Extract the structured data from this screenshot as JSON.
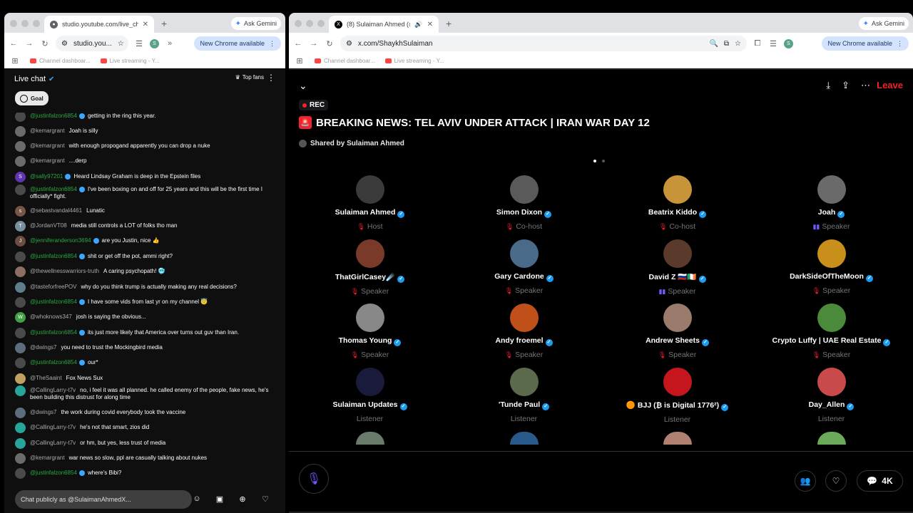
{
  "left_window": {
    "tab_title": "studio.youtube.com/live_cha",
    "ask_gemini": "Ask Gemini",
    "url": "studio.you...",
    "new_chrome": "New Chrome available",
    "profile_initial": "S",
    "bookmarks": [
      "Channel dashboar...",
      "Live streaming - Y..."
    ]
  },
  "chat": {
    "title": "Live chat",
    "top_fans": "Top fans",
    "goal": "Goal",
    "input_placeholder": "Chat publicly as @SulaimanAhmedX...",
    "messages": [
      {
        "author": "@justinfalzon6854",
        "member": true,
        "text": "getting in the ring this year.",
        "color": "#4a4a4a"
      },
      {
        "author": "@kemargrant",
        "member": false,
        "text": "Joah is silly",
        "color": "#6b6b6b"
      },
      {
        "author": "@kemargrant",
        "member": false,
        "text": "with enough propogand apparently you can drop a nuke",
        "color": "#6b6b6b"
      },
      {
        "author": "@kemargrant",
        "member": false,
        "text": "....derp",
        "color": "#6b6b6b"
      },
      {
        "author": "@sally97201",
        "member": true,
        "text": "Heard Lindsay Graham is deep in the Epstein files",
        "color": "#5e35b1",
        "initial": "S"
      },
      {
        "author": "@justinfalzon6854",
        "member": true,
        "text": "I've been boxing on and off for 25 years and this will be the first time I officially* fight.",
        "color": "#4a4a4a"
      },
      {
        "author": "@sebastvandal4461",
        "member": false,
        "text": "Lunatic",
        "color": "#795548",
        "initial": "s"
      },
      {
        "author": "@JordanVT08",
        "member": false,
        "text": "media still controls a LOT of folks tho man",
        "color": "#78909c",
        "initial": "T"
      },
      {
        "author": "@jenniferanderson3694",
        "member": true,
        "text": "are you Justin, nice 👍",
        "color": "#6d4c41",
        "initial": "J"
      },
      {
        "author": "@justinfalzon6854",
        "member": true,
        "text": "shit or get off the pot, ammi right?",
        "color": "#4a4a4a"
      },
      {
        "author": "@thewellnesswarriors-truth",
        "member": false,
        "text": "A caring psychopath! 🥶",
        "color": "#8d6e63"
      },
      {
        "author": "@tasteforfreePOV",
        "member": false,
        "text": "why do you think trump is actually making any real decisions?",
        "color": "#607d8b"
      },
      {
        "author": "@justinfalzon6854",
        "member": true,
        "text": "I have some vids from last yr on my channel 😇",
        "color": "#4a4a4a"
      },
      {
        "author": "@whoknows347",
        "member": false,
        "text": "josh is saying the obvious...",
        "color": "#43a047",
        "initial": "W"
      },
      {
        "author": "@justinfalzon6854",
        "member": true,
        "text": "its just more likely that America over turns out guv than Iran.",
        "color": "#4a4a4a"
      },
      {
        "author": "@dwings7",
        "member": false,
        "text": "you need to trust the Mockingbird media",
        "color": "#5d6d7e"
      },
      {
        "author": "@justinfalzon6854",
        "member": true,
        "text": "our*",
        "color": "#4a4a4a"
      },
      {
        "author": "@TheSaaint",
        "member": false,
        "text": "Fox News Sux",
        "color": "#c0a060"
      },
      {
        "author": "@CallingLarry-t7v",
        "member": false,
        "text": "no, i feel it was all planned. he called enemy of the people, fake news, he's been building this distrust for along time",
        "color": "#26a69a"
      },
      {
        "author": "@dwings7",
        "member": false,
        "text": "the work during covid everybody took the vaccine",
        "color": "#5d6d7e"
      },
      {
        "author": "@CallingLarry-t7v",
        "member": false,
        "text": "he's not that smart, zios did",
        "color": "#26a69a"
      },
      {
        "author": "@CallingLarry-t7v",
        "member": false,
        "text": "or hm, but yes, less trust of media",
        "color": "#26a69a"
      },
      {
        "author": "@kemargrant",
        "member": false,
        "text": "war news so slow, ppl are casually talking about nukes",
        "color": "#6b6b6b"
      },
      {
        "author": "@justinfalzon6854",
        "member": true,
        "text": "where's Bibi?",
        "color": "#4a4a4a"
      }
    ]
  },
  "right_window": {
    "tab_title": "(8) Sulaiman Ahmed (@Sh",
    "ask_gemini": "Ask Gemini",
    "url": "x.com/ShaykhSulaiman",
    "new_chrome": "New Chrome available",
    "profile_initial": "S",
    "bookmarks": [
      "Channel dashboar...",
      "Live streaming - Y..."
    ]
  },
  "space": {
    "rec": "REC",
    "title": "BREAKING NEWS: TEL AVIV UNDER ATTACK | IRAN WAR DAY 12",
    "shared_by": "Shared by Sulaiman Ahmed",
    "leave": "Leave",
    "comments_count": "4K",
    "participants": [
      {
        "name": "Sulaiman Ahmed",
        "role": "Host",
        "muted": true,
        "color": "#3b3b3b"
      },
      {
        "name": "Simon Dixon",
        "role": "Co-host",
        "muted": true,
        "color": "#5a5a5a"
      },
      {
        "name": "Beatrix Kiddo",
        "role": "Co-host",
        "muted": true,
        "color": "#c8943a"
      },
      {
        "name": "Joah",
        "role": "Speaker",
        "muted": false,
        "color": "#6a6a6a"
      },
      {
        "name": "ThatGirlCasey☄️",
        "role": "Speaker",
        "muted": true,
        "color": "#7a3a2a"
      },
      {
        "name": "Gary Cardone",
        "role": "Speaker",
        "muted": true,
        "color": "#4a6a8a"
      },
      {
        "name": "David Z 🇷🇺🇮🇪",
        "role": "Speaker",
        "muted": false,
        "color": "#5a3a2a"
      },
      {
        "name": "DarkSideOfTheMoon",
        "role": "Speaker",
        "muted": true,
        "color": "#c8901a"
      },
      {
        "name": "Thomas Young",
        "role": "Speaker",
        "muted": true,
        "color": "#888888"
      },
      {
        "name": "Andy froemel",
        "role": "Speaker",
        "muted": true,
        "color": "#c0501a"
      },
      {
        "name": "Andrew Sheets",
        "role": "Speaker",
        "muted": true,
        "color": "#9a7a6a"
      },
      {
        "name": "Crypto Luffy | UAE Real Estate",
        "role": "Speaker",
        "muted": true,
        "color": "#4a8a3a"
      },
      {
        "name": "Sulaiman Updates",
        "role": "Listener",
        "muted": false,
        "color": "#1a1a3a"
      },
      {
        "name": "'Tunde Paul",
        "role": "Listener",
        "muted": false,
        "color": "#5a6a4a"
      },
      {
        "name": "🟠 BJJ (₿ is Digital 1776²)",
        "role": "Listener",
        "muted": false,
        "color": "#c4161c"
      },
      {
        "name": "Day_Allen",
        "role": "Listener",
        "muted": false,
        "color": "#c84a4a"
      }
    ]
  }
}
